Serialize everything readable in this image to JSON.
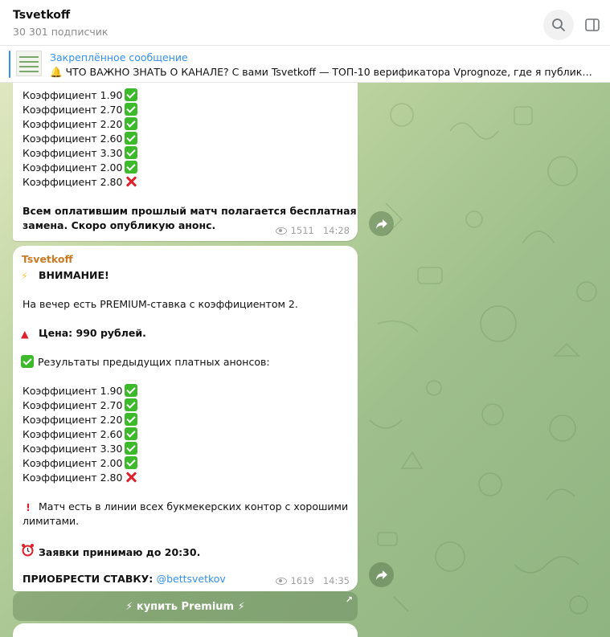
{
  "header": {
    "title": "Tsvetkoff",
    "subtitle": "30 301 подписчик"
  },
  "pinned": {
    "title": "Закреплённое сообщение",
    "text": "🔔 ЧТО ВАЖНО ЗНАТЬ О КАНАЛЕ?  С вами Tsvetkoff — ТОП-10 верификатора Vprognoze, где я публиковал …"
  },
  "message1": {
    "results": [
      {
        "text": "Коэффициент 1.90",
        "status": "check"
      },
      {
        "text": "Коэффициент 2.70",
        "status": "check"
      },
      {
        "text": "Коэффициент 2.20",
        "status": "check"
      },
      {
        "text": "Коэффициент 2.60",
        "status": "check"
      },
      {
        "text": "Коэффициент 3.30",
        "status": "check"
      },
      {
        "text": "Коэффициент 2.00",
        "status": "check"
      },
      {
        "text": "Коэффициент 2.80",
        "status": "cross"
      }
    ],
    "note_line1": "Всем оплатившим прошлый матч полагается бесплатная",
    "note_line2": "замена. Скоро опубликую анонс.",
    "views": "1511",
    "time": "14:28"
  },
  "message2": {
    "author": "Tsvetkoff",
    "attention": "ВНИМАНИЕ!",
    "line_evening": "На вечер есть PREMIUM-ставка с коэффициентом 2.",
    "price": "Цена: 990 рублей.",
    "prev_results": "Результаты предыдущих платных анонсов:",
    "results": [
      {
        "text": "Коэффициент 1.90",
        "status": "check"
      },
      {
        "text": "Коэффициент 2.70",
        "status": "check"
      },
      {
        "text": "Коэффициент 2.20",
        "status": "check"
      },
      {
        "text": "Коэффициент 2.60",
        "status": "check"
      },
      {
        "text": "Коэффициент 3.30",
        "status": "check"
      },
      {
        "text": "Коэффициент 2.00",
        "status": "check"
      },
      {
        "text": "Коэффициент 2.80",
        "status": "cross"
      }
    ],
    "match_line1": "Матч есть в линии всех букмекерских контор с хорошими",
    "match_line2": "лимитами.",
    "deadline": "Заявки принимаю до 20:30.",
    "buy_label": "ПРИОБРЕСТИ СТАВКУ: ",
    "buy_link": "@bettsvetkov",
    "views": "1619",
    "time": "14:35"
  },
  "inline_button": {
    "label": "⚡ купить Premium ⚡"
  },
  "colors": {
    "accent": "#3390ec",
    "author": "#c97b24",
    "check": "#3cba2c",
    "cross": "#e0202c"
  },
  "icons": [
    "search-icon",
    "side-panel-icon",
    "eye-icon",
    "share-icon",
    "lightning-icon",
    "red-triangle-icon",
    "check-icon",
    "cross-icon",
    "exclamation-icon",
    "alarm-clock-icon",
    "bell-icon"
  ]
}
